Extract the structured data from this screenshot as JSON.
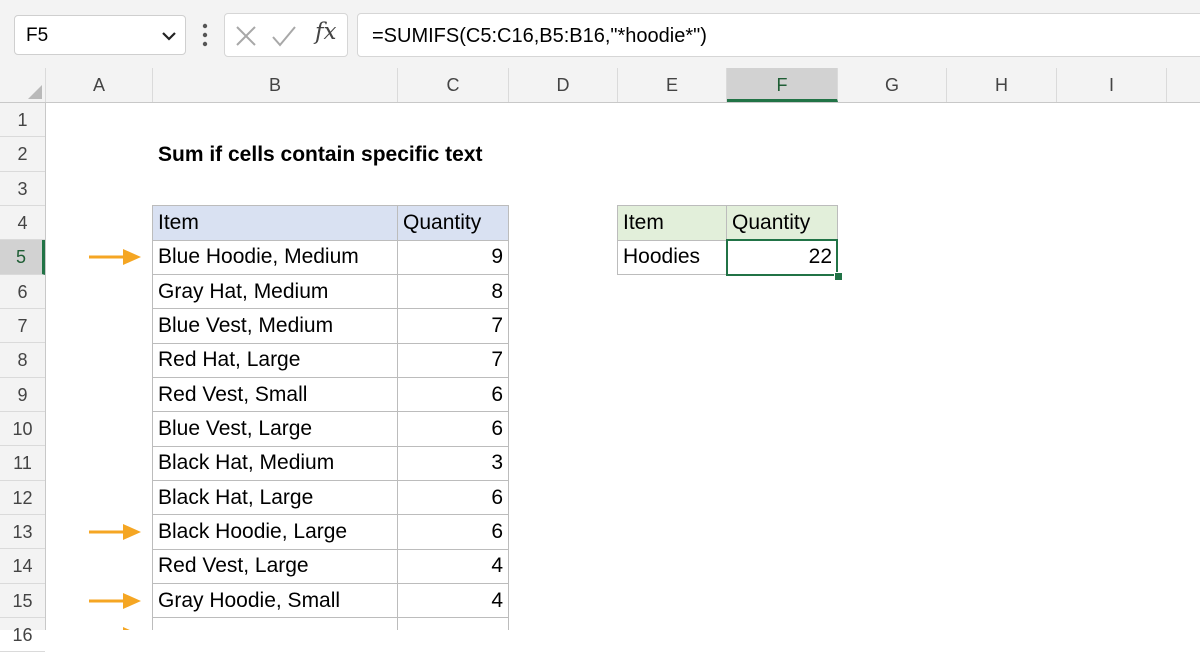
{
  "formula_bar": {
    "name_box": "F5",
    "cancel_icon": "x-icon",
    "enter_icon": "check-icon",
    "fx_label": "fx",
    "formula": "=SUMIFS(C5:C16,B5:B16,\"*hoodie*\")"
  },
  "sheet": {
    "columns": [
      "A",
      "B",
      "C",
      "D",
      "E",
      "F",
      "G",
      "H",
      "I"
    ],
    "rows": [
      "1",
      "2",
      "3",
      "4",
      "5",
      "6",
      "7",
      "8",
      "9",
      "10",
      "11",
      "12",
      "13",
      "14",
      "15",
      "16"
    ],
    "active_cell": "F5",
    "title": "Sum if cells contain specific text",
    "data_table": {
      "headers": [
        "Item",
        "Quantity"
      ],
      "rows": [
        {
          "item": "Blue Hoodie, Medium",
          "qty": "9"
        },
        {
          "item": "Gray Hat, Medium",
          "qty": "8"
        },
        {
          "item": "Blue Vest, Medium",
          "qty": "7"
        },
        {
          "item": "Red Hat, Large",
          "qty": "7"
        },
        {
          "item": "Red Vest, Small",
          "qty": "6"
        },
        {
          "item": "Blue Vest, Large",
          "qty": "6"
        },
        {
          "item": "Black Hat, Medium",
          "qty": "3"
        },
        {
          "item": "Black Hat, Large",
          "qty": "6"
        },
        {
          "item": "Black Hoodie, Large",
          "qty": "6"
        },
        {
          "item": "Red Vest, Large",
          "qty": "4"
        },
        {
          "item": "Gray Hoodie, Small",
          "qty": "4"
        }
      ]
    },
    "summary_table": {
      "headers": [
        "Item",
        "Quantity"
      ],
      "rows": [
        {
          "item": "Hoodies",
          "qty": "22"
        }
      ]
    },
    "arrow_rows": [
      "5",
      "13",
      "15",
      "16"
    ],
    "colors": {
      "arrow": "#f5a623",
      "header_blue": "#d9e1f2",
      "header_green": "#e2efda",
      "selection": "#217346"
    }
  }
}
